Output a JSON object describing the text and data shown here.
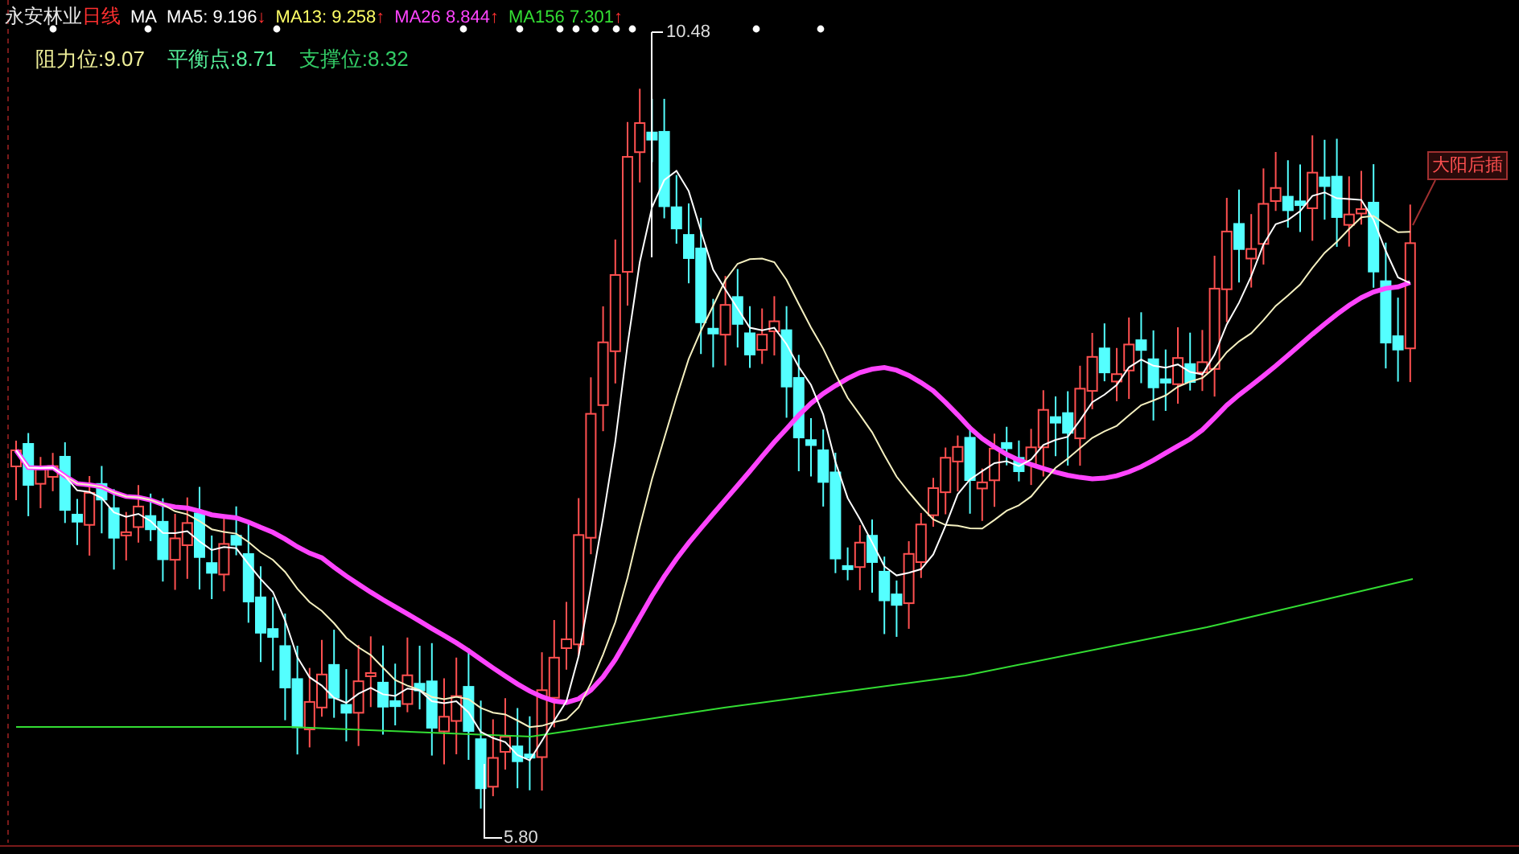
{
  "header": {
    "stock_name": "永安林业",
    "period": "日线",
    "indicator": "MA",
    "averages": [
      {
        "label": "MA5:",
        "value": "9.196",
        "arrow": "↓",
        "color": "#ffffff"
      },
      {
        "label": "MA13:",
        "value": "9.258",
        "arrow": "↑",
        "color": "#ffff66"
      },
      {
        "label": "MA26",
        "value": "8.844",
        "arrow": "↑",
        "color": "#ff44ff"
      },
      {
        "label": "MA156",
        "value": "7.301",
        "arrow": "↑",
        "color": "#33dd33"
      }
    ]
  },
  "levels": [
    {
      "label": "阻力位:",
      "value": "9.07",
      "color": "#eeee99"
    },
    {
      "label": "平衡点:",
      "value": "8.71",
      "color": "#55ee99"
    },
    {
      "label": "支撑位:",
      "value": "8.32",
      "color": "#33cc66"
    }
  ],
  "chart": {
    "high_label": "10.48",
    "low_label": "5.80",
    "signal_label": "大阳后插"
  }
}
